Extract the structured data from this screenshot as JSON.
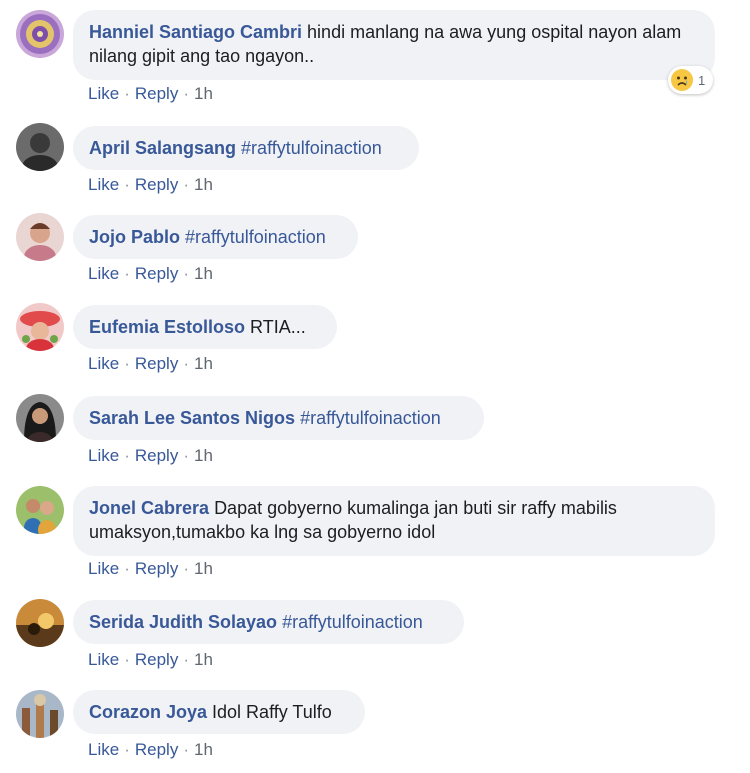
{
  "colors": {
    "link": "#385898",
    "bubble_bg": "#f0f2f5",
    "meta": "#606770",
    "text": "#1c1e21"
  },
  "comments": [
    {
      "author": "Hanniel Santiago Cambri",
      "text": "hindi manlang na awa yung ospital nayon alam nilang gipit ang tao ngayon..",
      "hashtag": "",
      "like": "Like",
      "reply": "Reply",
      "time": "1h",
      "reaction": {
        "icon": "sad-emoji-icon",
        "count": "1"
      }
    },
    {
      "author": "April Salangsang",
      "text": "",
      "hashtag": "#raffytulfoinaction",
      "like": "Like",
      "reply": "Reply",
      "time": "1h"
    },
    {
      "author": "Jojo Pablo",
      "text": "",
      "hashtag": "#raffytulfoinaction",
      "like": "Like",
      "reply": "Reply",
      "time": "1h"
    },
    {
      "author": "Eufemia Estolloso",
      "text": "RTIA...",
      "hashtag": "",
      "like": "Like",
      "reply": "Reply",
      "time": "1h"
    },
    {
      "author": "Sarah Lee Santos Nigos",
      "text": "",
      "hashtag": "#raffytulfoinaction",
      "like": "Like",
      "reply": "Reply",
      "time": "1h"
    },
    {
      "author": "Jonel Cabrera",
      "text": "Dapat gobyerno kumalinga jan buti sir raffy mabilis umaksyon,tumakbo ka lng sa gobyerno idol",
      "hashtag": "",
      "like": "Like",
      "reply": "Reply",
      "time": "1h"
    },
    {
      "author": "Serida Judith Solayao",
      "text": "",
      "hashtag": "#raffytulfoinaction",
      "like": "Like",
      "reply": "Reply",
      "time": "1h"
    },
    {
      "author": "Corazon Joya",
      "text": "Idol Raffy Tulfo",
      "hashtag": "",
      "like": "Like",
      "reply": "Reply",
      "time": "1h"
    }
  ]
}
